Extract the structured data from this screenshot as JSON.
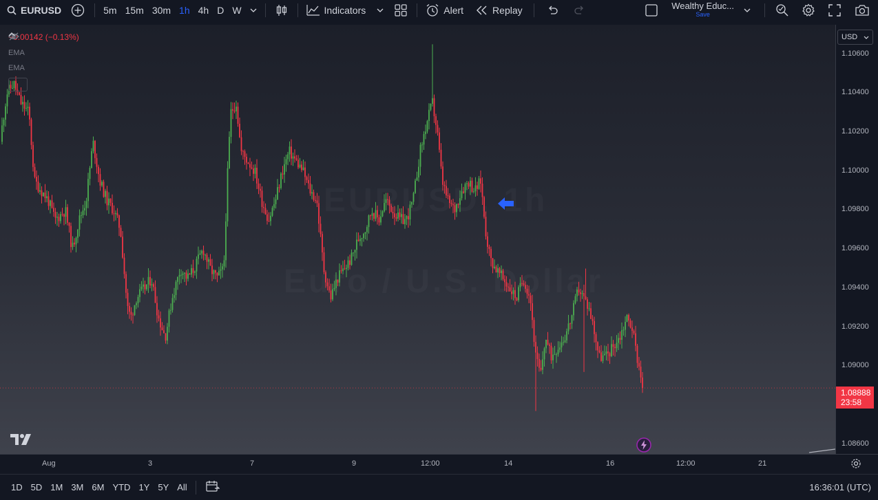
{
  "toolbar": {
    "symbol": "EURUSD",
    "timeframes": [
      "5m",
      "15m",
      "30m",
      "1h",
      "4h",
      "D",
      "W"
    ],
    "active_timeframe": "1h",
    "indicators_label": "Indicators",
    "alert_label": "Alert",
    "replay_label": "Replay",
    "layout_name": "Wealthy Educ...",
    "save_label": "Save"
  },
  "legend": {
    "change": "−0.00142 (−0.13%)",
    "ema_1": "EMA",
    "ema_2": "EMA"
  },
  "watermark": {
    "line1": "EURUSD, 1h",
    "line2": "Euro / U.S. Dollar"
  },
  "price_axis": {
    "currency": "USD",
    "ticks": [
      "1.10600",
      "1.10400",
      "1.10200",
      "1.10000",
      "1.09800",
      "1.09600",
      "1.09400",
      "1.09200",
      "1.09000",
      "1.08800",
      "1.08600"
    ],
    "current_price": "1.08888",
    "countdown": "23:58"
  },
  "time_axis": {
    "ticks": [
      "Aug",
      "3",
      "7",
      "9",
      "12:00",
      "14",
      "16",
      "12:00",
      "21"
    ]
  },
  "bottom": {
    "ranges": [
      "1D",
      "5D",
      "1M",
      "3M",
      "6M",
      "YTD",
      "1Y",
      "5Y",
      "All"
    ],
    "clock": "16:36:01 (UTC)"
  },
  "colors": {
    "up": "#4caf50",
    "down": "#f23645",
    "accent": "#2962ff",
    "background": "#131722"
  },
  "chart_data": {
    "type": "candlestick",
    "symbol": "EURUSD",
    "interval": "1h",
    "ylim": [
      1.0855,
      1.1075
    ],
    "close_path": [
      [
        0,
        1.1015
      ],
      [
        10,
        1.104
      ],
      [
        20,
        1.1045
      ],
      [
        30,
        1.1035
      ],
      [
        42,
        1.103
      ],
      [
        50,
        1.0995
      ],
      [
        60,
        1.099
      ],
      [
        70,
        1.0985
      ],
      [
        80,
        1.0975
      ],
      [
        95,
        1.098
      ],
      [
        105,
        1.096
      ],
      [
        115,
        1.0975
      ],
      [
        125,
        1.0985
      ],
      [
        135,
        1.1015
      ],
      [
        145,
        1.0995
      ],
      [
        155,
        1.0985
      ],
      [
        165,
        1.098
      ],
      [
        175,
        1.097
      ],
      [
        185,
        1.093
      ],
      [
        190,
        1.0925
      ],
      [
        198,
        1.0935
      ],
      [
        210,
        1.094
      ],
      [
        220,
        1.0945
      ],
      [
        230,
        1.0925
      ],
      [
        240,
        1.0915
      ],
      [
        250,
        1.0935
      ],
      [
        262,
        1.095
      ],
      [
        272,
        1.0945
      ],
      [
        282,
        1.095
      ],
      [
        295,
        1.096
      ],
      [
        305,
        1.095
      ],
      [
        315,
        1.0945
      ],
      [
        325,
        1.095
      ],
      [
        330,
        1.0995
      ],
      [
        335,
        1.103
      ],
      [
        343,
        1.1035
      ],
      [
        350,
        1.101
      ],
      [
        360,
        1.1005
      ],
      [
        370,
        1.1
      ],
      [
        380,
        1.0985
      ],
      [
        390,
        1.0975
      ],
      [
        400,
        1.0985
      ],
      [
        410,
        1.1
      ],
      [
        420,
        1.101
      ],
      [
        430,
        1.1005
      ],
      [
        440,
        1.1
      ],
      [
        450,
        1.099
      ],
      [
        460,
        1.0985
      ],
      [
        470,
        1.095
      ],
      [
        480,
        1.0935
      ],
      [
        490,
        1.0945
      ],
      [
        500,
        1.095
      ],
      [
        510,
        1.0955
      ],
      [
        520,
        1.0965
      ],
      [
        530,
        1.097
      ],
      [
        540,
        1.098
      ],
      [
        550,
        1.0975
      ],
      [
        560,
        1.0985
      ],
      [
        570,
        1.098
      ],
      [
        580,
        1.0975
      ],
      [
        590,
        1.0975
      ],
      [
        600,
        1.0985
      ],
      [
        610,
        1.101
      ],
      [
        620,
        1.1025
      ],
      [
        628,
        1.1035
      ],
      [
        635,
        1.102
      ],
      [
        642,
        1.0995
      ],
      [
        650,
        1.0985
      ],
      [
        660,
        1.098
      ],
      [
        670,
        1.099
      ],
      [
        680,
        1.0995
      ],
      [
        690,
        1.099
      ],
      [
        698,
        1.0995
      ],
      [
        705,
        1.097
      ],
      [
        712,
        1.0955
      ],
      [
        720,
        1.095
      ],
      [
        730,
        1.0945
      ],
      [
        740,
        1.094
      ],
      [
        750,
        1.0935
      ],
      [
        760,
        1.0945
      ],
      [
        770,
        1.0935
      ],
      [
        778,
        1.0905
      ],
      [
        785,
        1.0895
      ],
      [
        792,
        1.0915
      ],
      [
        800,
        1.0905
      ],
      [
        810,
        1.091
      ],
      [
        820,
        1.0915
      ],
      [
        830,
        1.0925
      ],
      [
        840,
        1.094
      ],
      [
        848,
        1.0935
      ],
      [
        855,
        1.093
      ],
      [
        862,
        1.092
      ],
      [
        870,
        1.0905
      ],
      [
        880,
        1.0905
      ],
      [
        890,
        1.091
      ],
      [
        900,
        1.0915
      ],
      [
        910,
        1.0925
      ],
      [
        918,
        1.092
      ],
      [
        925,
        1.0905
      ],
      [
        935,
        1.0889
      ]
    ],
    "spikes": [
      {
        "x": 627,
        "high": 1.1065
      },
      {
        "x": 778,
        "low": 1.0877
      },
      {
        "x": 851,
        "high": 1.095
      },
      {
        "x": 849,
        "low": 1.0897
      }
    ]
  }
}
